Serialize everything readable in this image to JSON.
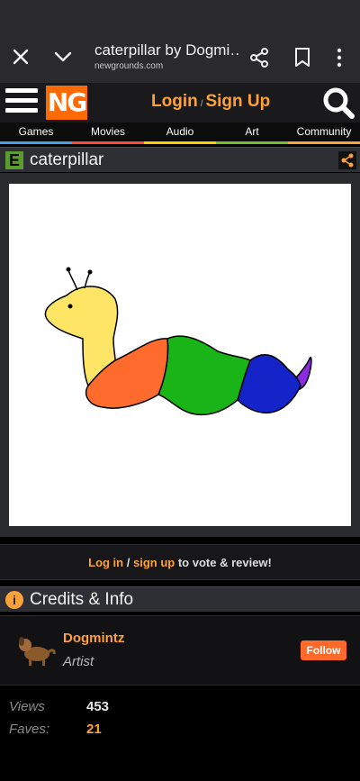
{
  "browser": {
    "tab_title": "caterpillar by Dogmi…",
    "url": "newgrounds.com"
  },
  "header": {
    "logo_text": "NG",
    "login": "Login",
    "separator": "/",
    "signup": "Sign Up"
  },
  "nav": {
    "items": [
      "Games",
      "Movies",
      "Audio",
      "Art",
      "Community"
    ],
    "colors": [
      "#42a1e7",
      "#ff4a3b",
      "#ffcc00",
      "#72c02c",
      "#fda238"
    ]
  },
  "art": {
    "title": "caterpillar"
  },
  "vote": {
    "login": "Log in",
    "sep": "/",
    "signup": "sign up",
    "suffix": "to vote & review!"
  },
  "credits": {
    "title": "Credits & Info",
    "artist_name": "Dogmintz",
    "artist_role": "Artist",
    "follow_label": "Follow"
  },
  "stats": {
    "views_label": "Views",
    "views_value": "453",
    "faves_label": "Faves:",
    "faves_value": "21"
  },
  "colors": {
    "accent": "#fda238",
    "ng_orange": "#ff6a00"
  }
}
